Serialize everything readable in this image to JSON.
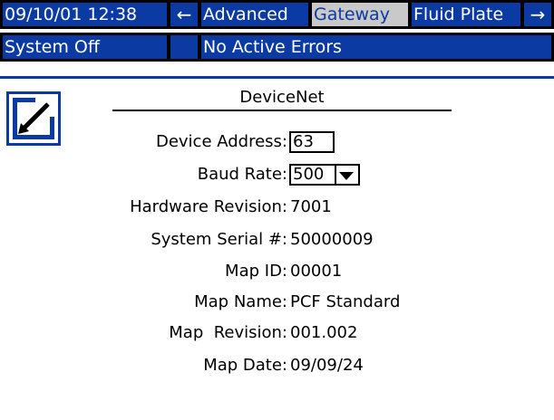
{
  "header": {
    "datetime": "09/10/01 12:38",
    "left_arrow": "←",
    "tabs": [
      {
        "label": "Advanced"
      },
      {
        "label": "Gateway",
        "selected": true
      },
      {
        "label": "Fluid Plate"
      }
    ],
    "right_arrow": "→"
  },
  "status": {
    "system_state": "System Off",
    "indicator": "",
    "errors": "No Active Errors"
  },
  "colors": {
    "accent": "#0b3aa3",
    "selected_tab_bg": "#c9c9c9"
  },
  "edit_button": {
    "icon": "edit-icon"
  },
  "screen": {
    "title": "DeviceNet",
    "fields": {
      "device_address": {
        "label": "Device Address:",
        "value": "63"
      },
      "baud_rate": {
        "label": "Baud Rate:",
        "value": "500"
      },
      "hardware_revision": {
        "label": "Hardware Revision:",
        "value": "7001"
      },
      "system_serial": {
        "label": "System Serial #:",
        "value": "50000009"
      },
      "map_id": {
        "label": "Map ID:",
        "value": "00001"
      },
      "map_name": {
        "label": "Map Name:",
        "value": "PCF Standard"
      },
      "map_revision": {
        "label": "Map  Revision:",
        "value": "001.002"
      },
      "map_date": {
        "label": "Map Date:",
        "value": "09/09/24"
      }
    }
  }
}
